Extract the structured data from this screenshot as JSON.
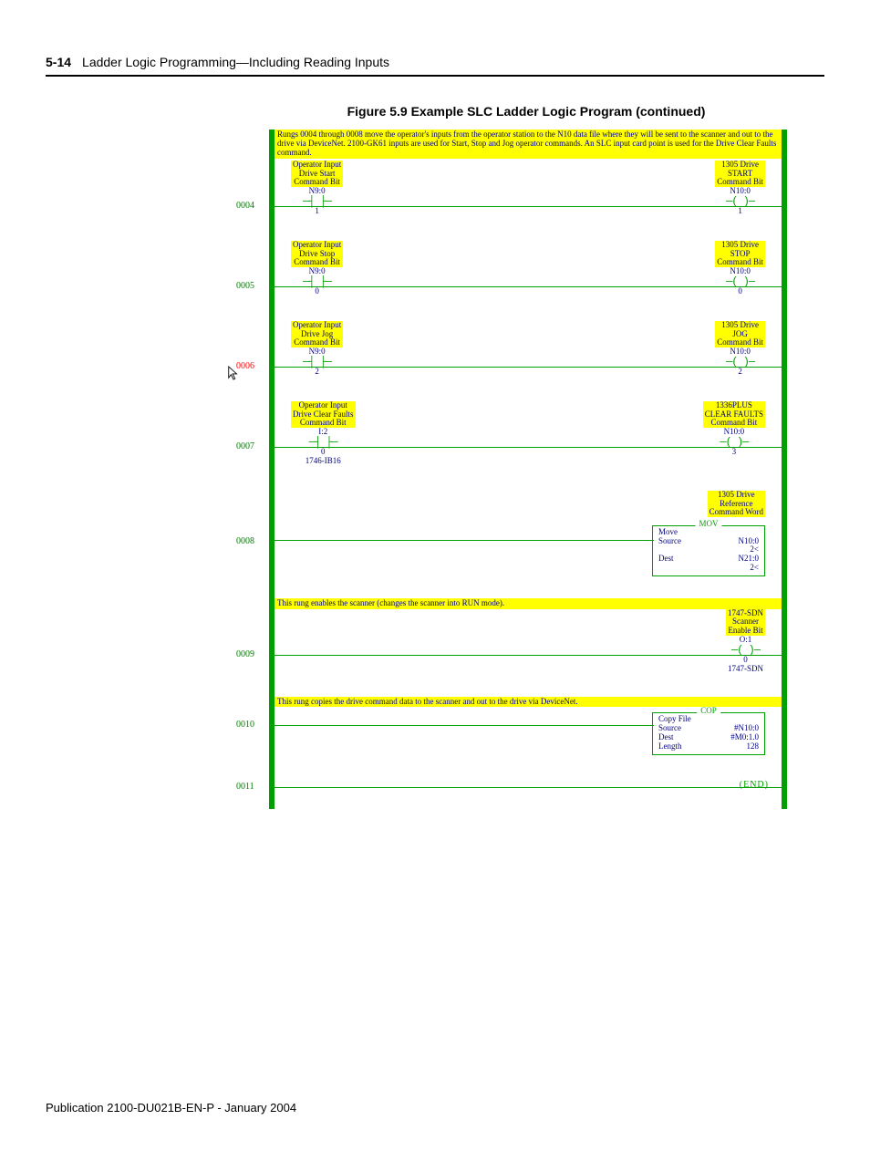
{
  "header": {
    "page_number": "5-14",
    "chapter_title": "Ladder Logic Programming—Including Reading Inputs"
  },
  "figure_caption": "Figure 5.9  Example SLC Ladder Logic Program (continued)",
  "top_comment": "Rungs 0004 through 0008 move the operator's inputs from the operator station to the N10 data file where they will be sent to the scanner and out to the drive via DeviceNet.  2100-GK61 inputs are used for Start, Stop and Jog operator commands.  An SLC input card point is used for the Drive Clear Faults command.",
  "rungs": {
    "r4": {
      "num": "0004",
      "left_desc": "Operator Input\nDrive Start\nCommand Bit",
      "left_addr": "N9:0",
      "left_term": "1",
      "right_desc": "1305 Drive\nSTART\nCommand Bit",
      "right_addr": "N10:0",
      "right_term": "1"
    },
    "r5": {
      "num": "0005",
      "left_desc": "Operator Input\nDrive Stop\nCommand Bit",
      "left_addr": "N9:0",
      "left_term": "0",
      "right_desc": "1305 Drive\nSTOP\nCommand Bit",
      "right_addr": "N10:0",
      "right_term": "0"
    },
    "r6": {
      "num": "0006",
      "left_desc": "Operator Input\nDrive Jog\nCommand Bit",
      "left_addr": "N9:0",
      "left_term": "2",
      "right_desc": "1305 Drive\nJOG\nCommand Bit",
      "right_addr": "N10:0",
      "right_term": "2"
    },
    "r7": {
      "num": "0007",
      "left_desc": "Operator Input\nDrive Clear Faults\nCommand Bit",
      "left_addr": "I:2",
      "left_term": "0",
      "left_mod": "1746-IB16",
      "right_desc": "1336PLUS\nCLEAR FAULTS\nCommand Bit",
      "right_addr": "N10:0",
      "right_term": "3"
    },
    "r8": {
      "num": "0008",
      "right_desc": "1305 Drive\nReference\nCommand Word",
      "box_hdr": "MOV",
      "box_title": "Move",
      "src_lbl": "Source",
      "src_val": "N10:0",
      "src_sub": "2<",
      "dst_lbl": "Dest",
      "dst_val": "N21:0",
      "dst_sub": "2<"
    },
    "r9": {
      "num": "0009",
      "comment": "This rung enables the scanner (changes the scanner into RUN mode).",
      "right_desc": "1747-SDN\nScanner\nEnable Bit",
      "right_addr": "O:1",
      "right_term": "0",
      "right_mod": "1747-SDN"
    },
    "r10": {
      "num": "0010",
      "comment": "This rung copies the drive command data to the scanner and out to the drive via DeviceNet.",
      "box_hdr": "COP",
      "box_title": "Copy File",
      "src_lbl": "Source",
      "src_val": "#N10:0",
      "dst_lbl": "Dest",
      "dst_val": "#M0:1.0",
      "len_lbl": "Length",
      "len_val": "128"
    },
    "r11": {
      "num": "0011",
      "end": "END"
    }
  },
  "footer": "Publication 2100-DU021B-EN-P - January 2004"
}
